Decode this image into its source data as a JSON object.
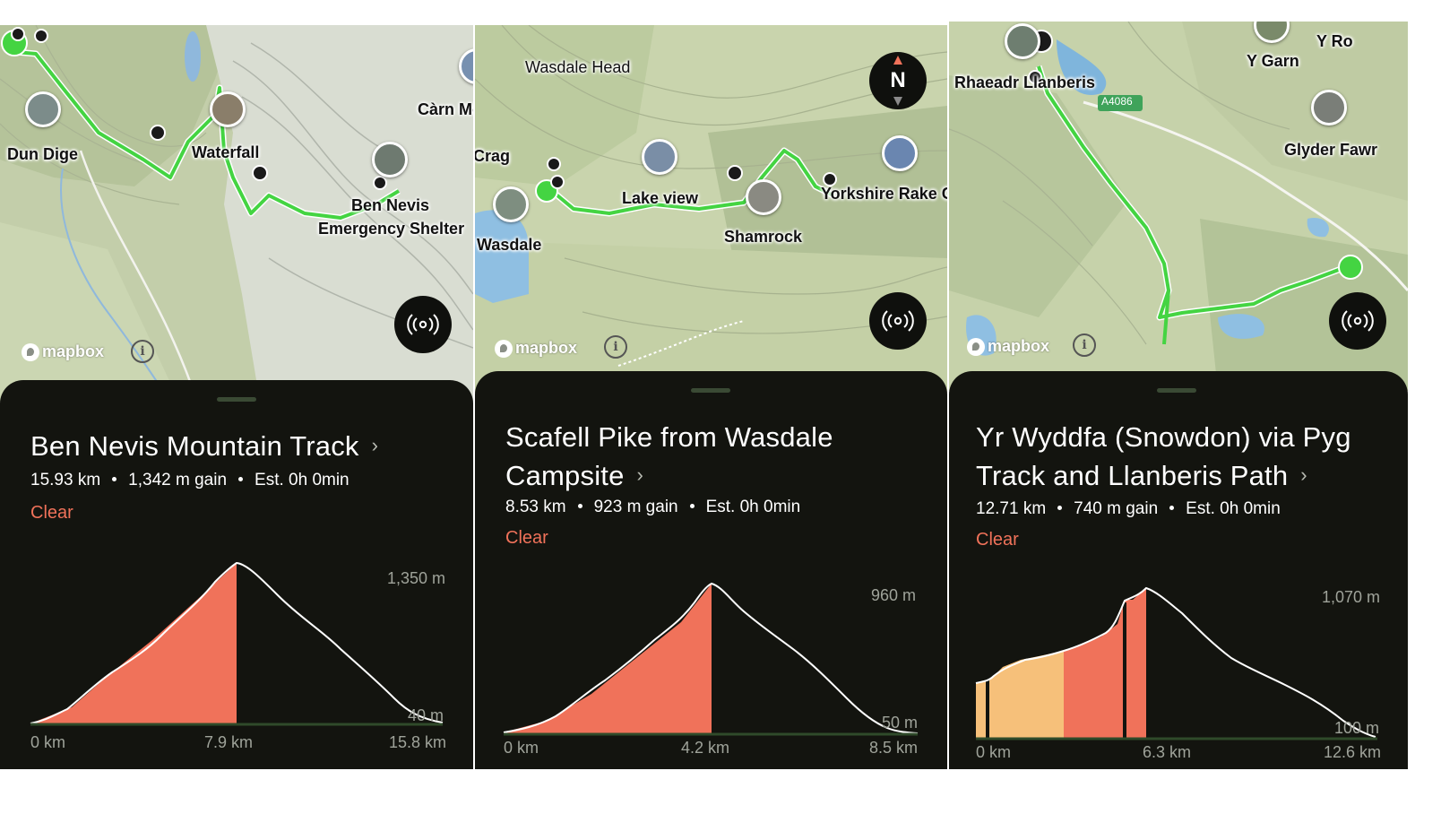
{
  "colors": {
    "sheet": "#13140f",
    "route": "#44d442",
    "accent": "#f0725a",
    "climb_alt": "#f6c07a",
    "map_bg": "#c8d3ad"
  },
  "panels": [
    {
      "map": {
        "labels": [
          "Dun Dige",
          "Waterfall",
          "Ben Nevis",
          "Emergency Shelter",
          "Càrn Mò"
        ],
        "attribution": "mapbox",
        "info_icon": "info-icon",
        "broadcast_icon": "broadcast-icon"
      },
      "route": {
        "title": "Ben Nevis Mountain Track",
        "distance": "15.93 km",
        "gain": "1,342 m gain",
        "estimate": "Est. 0h 0min",
        "clear": "Clear"
      },
      "elevation": {
        "y_max_label": "1,350 m",
        "y_min_label": "40 m",
        "x_labels": [
          "0 km",
          "7.9 km",
          "15.8 km"
        ],
        "y_range": [
          40,
          1350
        ],
        "x_range": [
          0,
          15.8
        ],
        "highlight_end_fraction": 0.5
      }
    },
    {
      "map": {
        "labels": [
          "Wasdale Head",
          "Crag",
          "Wasdale",
          "Lake view",
          "Shamrock",
          "Yorkshire Rake Cr"
        ],
        "attribution": "mapbox",
        "compass": "N",
        "info_icon": "info-icon",
        "broadcast_icon": "broadcast-icon"
      },
      "route": {
        "title_line1": "Scafell Pike from Wasdale",
        "title_line2": "Campsite",
        "distance": "8.53 km",
        "gain": "923 m gain",
        "estimate": "Est. 0h 0min",
        "clear": "Clear"
      },
      "elevation": {
        "y_max_label": "960 m",
        "y_min_label": "50 m",
        "x_labels": [
          "0 km",
          "4.2 km",
          "8.5 km"
        ],
        "y_range": [
          50,
          960
        ],
        "x_range": [
          0,
          8.5
        ],
        "highlight_end_fraction": 0.5
      }
    },
    {
      "map": {
        "labels": [
          "Rhaeadr Llanberis",
          "Y Garn",
          "Y Ro",
          "Glyder Fawr",
          "A4086"
        ],
        "attribution": "mapbox",
        "info_icon": "info-icon",
        "broadcast_icon": "broadcast-icon"
      },
      "route": {
        "title_line1": "Yr Wyddfa (Snowdon) via Pyg",
        "title_line2": "Track and Llanberis Path",
        "distance": "12.71 km",
        "gain": "740 m gain",
        "estimate": "Est. 0h 0min",
        "clear": "Clear"
      },
      "elevation": {
        "y_max_label": "1,070 m",
        "y_min_label": "100 m",
        "x_labels": [
          "0 km",
          "6.3 km",
          "12.6 km"
        ],
        "y_range": [
          100,
          1070
        ],
        "x_range": [
          0,
          12.6
        ],
        "highlight_end_fraction": 0.5
      }
    }
  ]
}
